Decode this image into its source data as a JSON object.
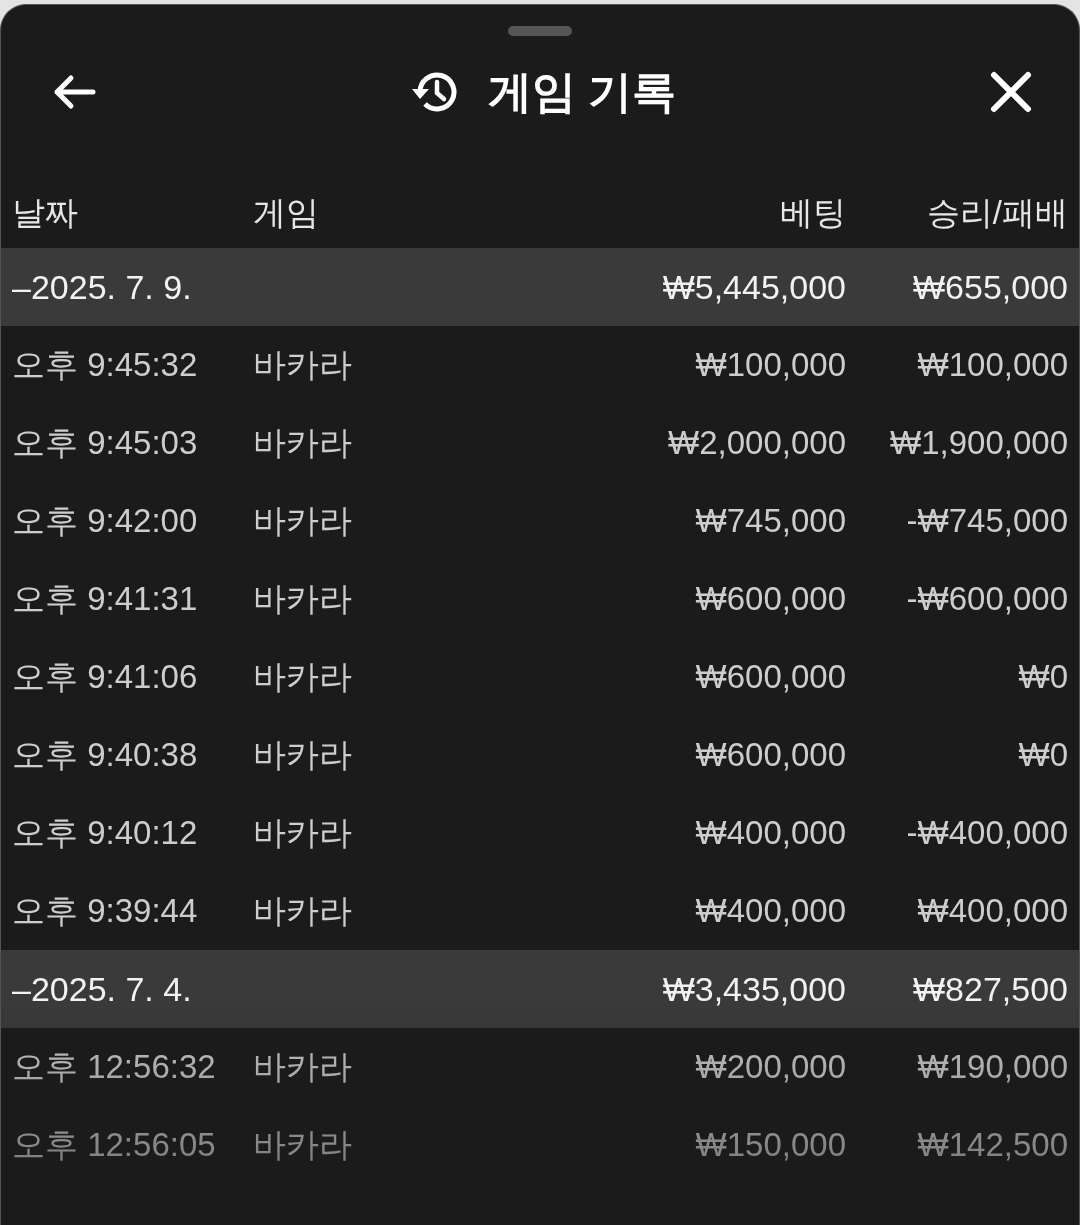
{
  "header": {
    "title": "게임 기록"
  },
  "columns": [
    "날짜",
    "게임",
    "베팅",
    "승리/패배"
  ],
  "groups": [
    {
      "date": "–2025. 7. 9.",
      "bet": "₩5,445,000",
      "result": "₩655,000",
      "rows": [
        {
          "time": "오후 9:45:32",
          "game": "바카라",
          "bet": "₩100,000",
          "result": "₩100,000"
        },
        {
          "time": "오후 9:45:03",
          "game": "바카라",
          "bet": "₩2,000,000",
          "result": "₩1,900,000"
        },
        {
          "time": "오후 9:42:00",
          "game": "바카라",
          "bet": "₩745,000",
          "result": "-₩745,000"
        },
        {
          "time": "오후 9:41:31",
          "game": "바카라",
          "bet": "₩600,000",
          "result": "-₩600,000"
        },
        {
          "time": "오후 9:41:06",
          "game": "바카라",
          "bet": "₩600,000",
          "result": "₩0"
        },
        {
          "time": "오후 9:40:38",
          "game": "바카라",
          "bet": "₩600,000",
          "result": "₩0"
        },
        {
          "time": "오후 9:40:12",
          "game": "바카라",
          "bet": "₩400,000",
          "result": "-₩400,000"
        },
        {
          "time": "오후 9:39:44",
          "game": "바카라",
          "bet": "₩400,000",
          "result": "₩400,000"
        }
      ]
    },
    {
      "date": "–2025. 7. 4.",
      "bet": "₩3,435,000",
      "result": "₩827,500",
      "rows": [
        {
          "time": "오후 12:56:32",
          "game": "바카라",
          "bet": "₩200,000",
          "result": "₩190,000"
        },
        {
          "time": "오후 12:56:05",
          "game": "바카라",
          "bet": "₩150,000",
          "result": "₩142,500"
        }
      ]
    }
  ]
}
